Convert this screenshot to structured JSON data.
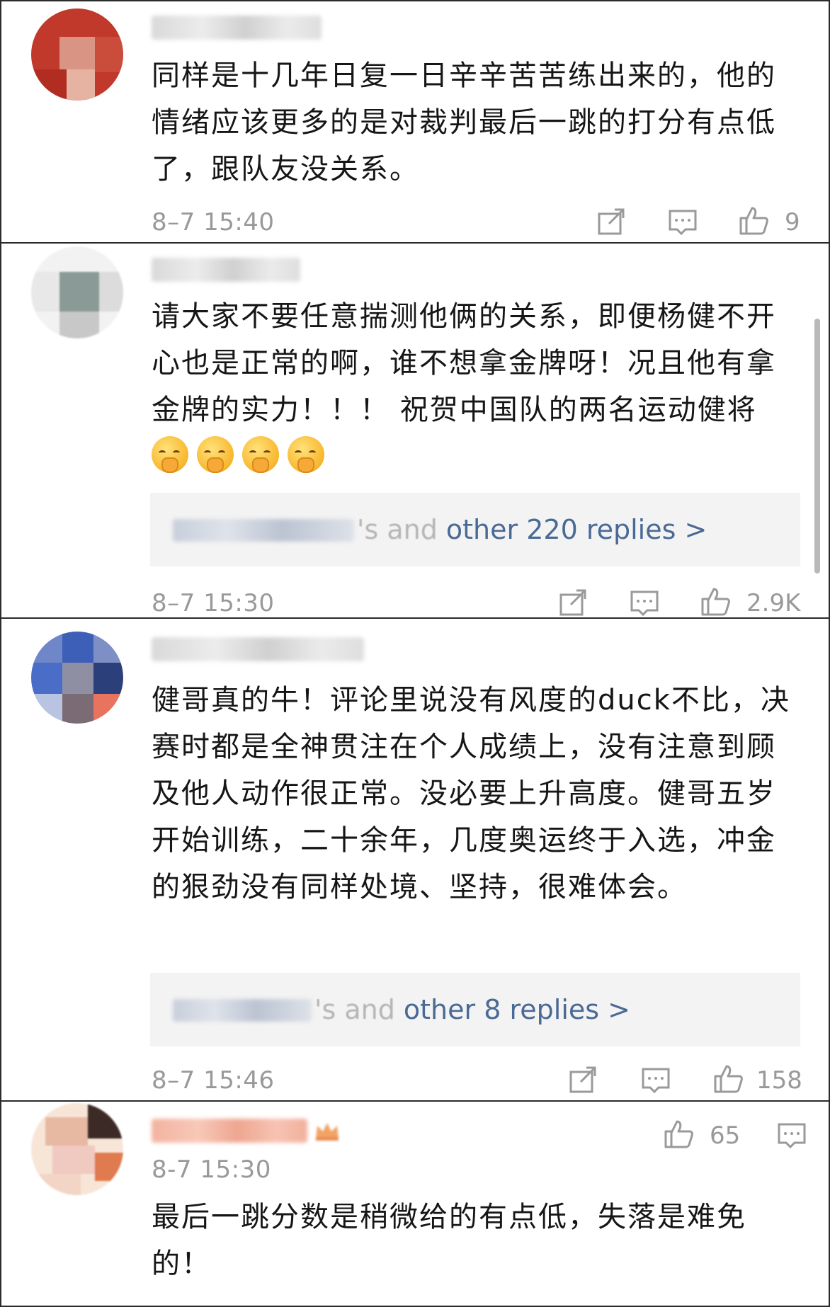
{
  "comments": [
    {
      "text": "同样是十几年日复一日辛辛苦苦练出来的，他的情绪应该更多的是对裁判最后一跳的打分有点低了，跟队友没关系。",
      "time": "8–7 15:40",
      "likes": "9",
      "icons": [
        "share-icon",
        "comment-icon",
        "like-icon"
      ]
    },
    {
      "text": "请大家不要任意揣测他俩的关系，即便杨健不开心也是正常的啊，谁不想拿金牌呀！况且他有拿金牌的实力！！！ 祝贺中国队的两名运动健将",
      "emoji_count": 4,
      "emoji_icon": "shushing-face-emoji",
      "reply_suffix": "'s and ",
      "reply_link": "other 220 replies >",
      "time": "8–7 15:30",
      "likes": "2.9K"
    },
    {
      "text": "健哥真的牛！评论里说没有风度的duck不比，决赛时都是全神贯注在个人成绩上，没有注意到顾及他人动作很正常。没必要上升高度。健哥五岁开始训练，二十余年，几度奥运终于入选，冲金的狠劲没有同样处境、坚持，很难体会。",
      "reply_suffix": "'s and ",
      "reply_link": "other 8 replies >",
      "time": "8–7 15:46",
      "likes": "158"
    },
    {
      "text": "最后一跳分数是稍微给的有点低，失落是难免的！",
      "time": "8-7 15:30",
      "likes": "65"
    }
  ],
  "colors": {
    "link": "#4a6a96",
    "meta": "#999999",
    "reply_bg": "#f3f3f3"
  }
}
